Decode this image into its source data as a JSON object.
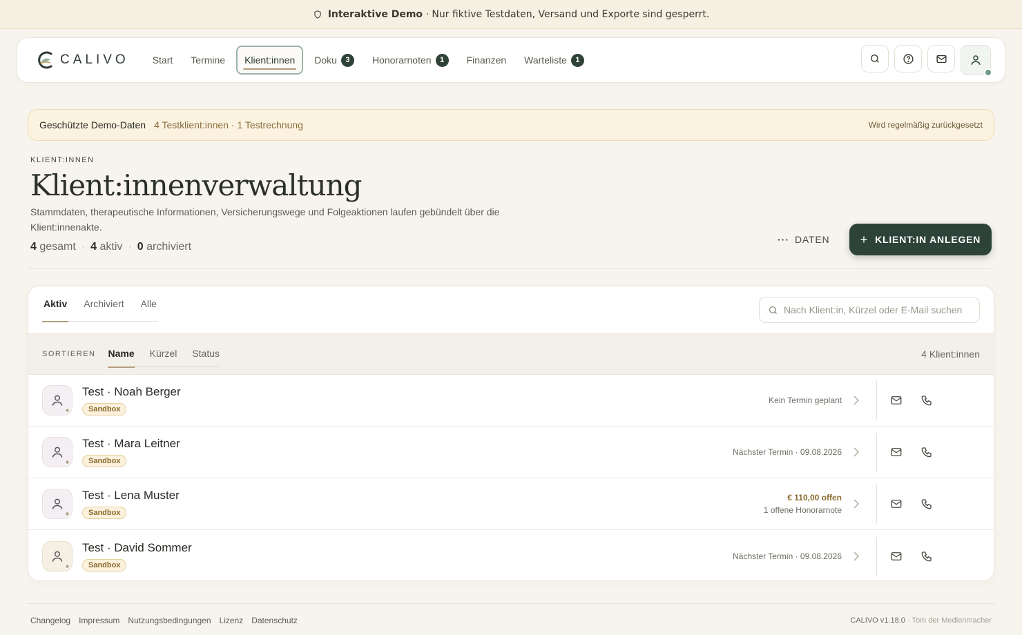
{
  "banner": {
    "strong": "Interaktive Demo",
    "text": " · Nur fiktive Testdaten, Versand und Exporte sind gesperrt."
  },
  "brand": {
    "name": "CALIVO"
  },
  "nav": {
    "items": [
      {
        "label": "Start"
      },
      {
        "label": "Termine"
      },
      {
        "label": "Klient:innen",
        "active": true
      },
      {
        "label": "Doku",
        "badge": "3"
      },
      {
        "label": "Honorarnoten",
        "badge": "1"
      },
      {
        "label": "Finanzen"
      },
      {
        "label": "Warteliste",
        "badge": "1"
      }
    ],
    "icons": [
      "search-icon",
      "help-icon",
      "mail-icon",
      "user-icon"
    ]
  },
  "notice": {
    "title": "Geschützte Demo-Daten",
    "sub": "4 Testklient:innen · 1 Testrechnung",
    "right": "Wird regelmäßig zurückgesetzt"
  },
  "header": {
    "eyebrow": "KLIENT:INNEN",
    "title": "Klient:innenverwaltung",
    "description": "Stammdaten, therapeutische Informationen, Versicherungswege und Folgeaktionen laufen gebündelt über die Klient:innenakte.",
    "stats": {
      "total_num": "4",
      "total_label": "gesamt",
      "active_num": "4",
      "active_label": "aktiv",
      "archived_num": "0",
      "archived_label": "archiviert"
    },
    "data_button": "DATEN",
    "add_button": "KLIENT:IN ANLEGEN"
  },
  "list": {
    "tabs": [
      "Aktiv",
      "Archiviert",
      "Alle"
    ],
    "search_placeholder": "Nach Klient:in, Kürzel oder E-Mail suchen",
    "sort_label": "SORTIEREN",
    "sort_options": [
      "Name",
      "Kürzel",
      "Status"
    ],
    "count": "4 Klient:innen",
    "rows": [
      {
        "name": "Test · Noah Berger",
        "badge": "Sandbox",
        "meta": "Kein Termin geplant"
      },
      {
        "name": "Test · Mara Leitner",
        "badge": "Sandbox",
        "meta": "Nächster Termin · 09.08.2026"
      },
      {
        "name": "Test · Lena Muster",
        "badge": "Sandbox",
        "meta_strong": "€ 110,00 offen",
        "meta": "1 offene Honorarnote"
      },
      {
        "name": "Test · David Sommer",
        "badge": "Sandbox",
        "meta": "Nächster Termin · 09.08.2026"
      }
    ]
  },
  "footer": {
    "links": [
      "Changelog",
      "Impressum",
      "Nutzungsbedingungen",
      "Lizenz",
      "Datenschutz"
    ],
    "version": "CALIVO v1.18.0",
    "credit": " · Tom der Medienmacher"
  },
  "colors": {
    "accent_dark": "#2d4339",
    "accent_gold": "#b49d7c",
    "background": "#f7f4ee",
    "status_online": "#6d9b86"
  }
}
